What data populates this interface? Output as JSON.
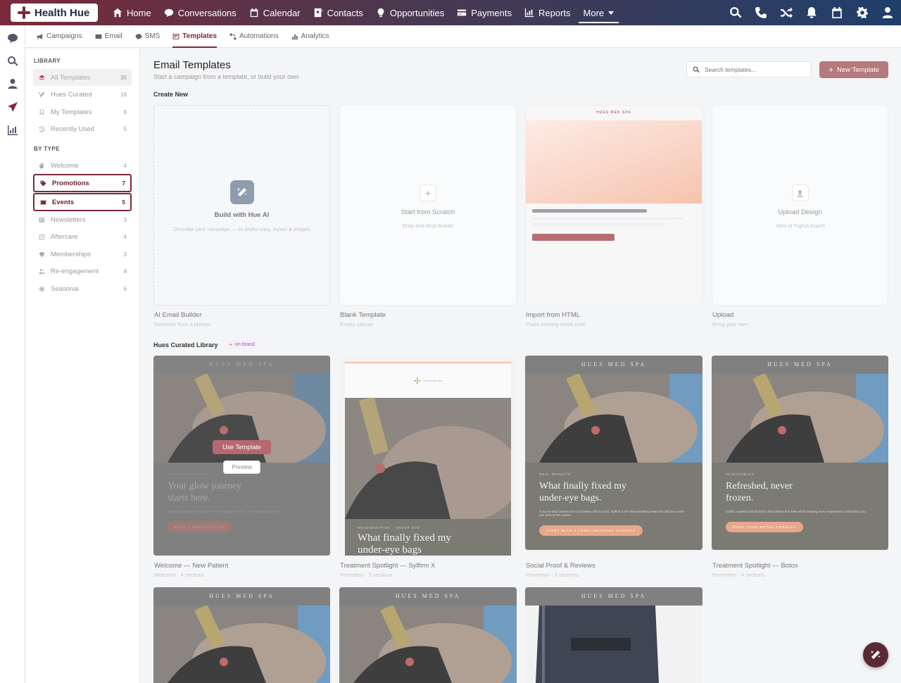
{
  "brand": {
    "name": "Health Hue"
  },
  "nav": {
    "items": [
      {
        "label": "Home",
        "icon": "home-icon"
      },
      {
        "label": "Conversations",
        "icon": "chat-icon"
      },
      {
        "label": "Calendar",
        "icon": "calendar-icon"
      },
      {
        "label": "Contacts",
        "icon": "contacts-icon"
      },
      {
        "label": "Opportunities",
        "icon": "lightbulb-icon"
      },
      {
        "label": "Payments",
        "icon": "credit-card-icon"
      },
      {
        "label": "Reports",
        "icon": "chart-icon"
      },
      {
        "label": "More",
        "icon": "chevron-down-icon"
      }
    ]
  },
  "subnav": {
    "items": [
      {
        "label": "Campaigns"
      },
      {
        "label": "Email"
      },
      {
        "label": "SMS"
      },
      {
        "label": "Templates"
      },
      {
        "label": "Automations"
      },
      {
        "label": "Analytics"
      }
    ],
    "active": "Templates"
  },
  "sidebar": {
    "library_title": "LIBRARY",
    "library": [
      {
        "label": "All Templates",
        "count": "36"
      },
      {
        "label": "Hues Curated",
        "count": "18"
      },
      {
        "label": "My Templates",
        "count": "9"
      },
      {
        "label": "Recently Used",
        "count": "5"
      }
    ],
    "type_title": "BY TYPE",
    "types": [
      {
        "label": "Welcome",
        "count": "4"
      },
      {
        "label": "Promotions",
        "count": "7"
      },
      {
        "label": "Events",
        "count": "5"
      },
      {
        "label": "Newsletters",
        "count": "3"
      },
      {
        "label": "Aftercare",
        "count": "4"
      },
      {
        "label": "Memberships",
        "count": "3"
      },
      {
        "label": "Re-engagement",
        "count": "4"
      },
      {
        "label": "Seasonal",
        "count": "6"
      }
    ]
  },
  "main": {
    "title": "Email Templates",
    "subtitle": "Start a campaign from a template, or build your own",
    "search_placeholder": "Search templates...",
    "new_button": "New Template",
    "create_new_title": "Create New",
    "create_cards": [
      {
        "inner_title": "Build with Hue AI",
        "inner_desc": "Describe your campaign — AI drafts copy, layout & images",
        "caption": "AI Email Builder",
        "caption_sub": "Generate from a prompt"
      },
      {
        "inner_title": "Start from Scratch",
        "inner_desc": "Drag-and-drop builder",
        "caption": "Blank Template",
        "caption_sub": "Empty canvas"
      },
      {
        "inner_title": "HUES MED SPA",
        "inner_desc": "",
        "caption": "Import from HTML",
        "caption_sub": "Paste existing email code"
      },
      {
        "inner_title": "Upload Design",
        "inner_desc": ".html or Figma export",
        "caption": "Upload",
        "caption_sub": "Bring your own"
      }
    ],
    "curated_title": "Hues Curated Library",
    "curated_badge": "on-brand",
    "templates": [
      {
        "header": "HUES MED SPA",
        "eyebrow": "WELCOME TO HUES",
        "headline": "Your glow journey starts here.",
        "copy": "Welcome to Hues Med Spa — we're so glad you're here. Your first visit is on us.",
        "cta": "BOOK A CONSULTATION",
        "caption": "Welcome — New Patient",
        "meta": "Welcome · 4 sections",
        "use_label": "Use Template",
        "preview_label": "Preview"
      },
      {
        "header": "Hues Med Spa",
        "eyebrow": "REGENERATIVE · UNDER EYE",
        "headline": "What finally fixed my under-eye bags",
        "copy": "",
        "cta": "",
        "caption": "Treatment Spotlight — Sylfirm X",
        "meta": "Promotion · 5 sections"
      },
      {
        "header": "HUES MED SPA",
        "eyebrow": "REAL RESULTS",
        "headline": "What finally fixed my under-eye bags.",
        "copy": "If you've tried creams and concealers with no luck, Sylfirm X RF Microneedling treats the delicate under-eye area at the source.",
        "cta": "START WITH A COMPLIMENTARY CONSULT",
        "caption": "Social Proof & Reviews",
        "meta": "Promotion · 6 sections"
      },
      {
        "header": "HUES MED SPA",
        "eyebrow": "INJECTABLES",
        "headline": "Refreshed, never frozen.",
        "copy": "Subtle, expertly placed Botox that softens fine lines while keeping every expression comfortably you.",
        "cta": "BOOK YOUR BOTOX CONSULT",
        "caption": "Treatment Spotlight — Botox",
        "meta": "Promotion · 4 sections"
      },
      {
        "header": "HUES MED SPA"
      },
      {
        "header": "HUES MED SPA"
      },
      {
        "header": "HUES MED SPA"
      }
    ]
  },
  "colors": {
    "accent": "#7a2a3a",
    "button": "#b47a7e"
  }
}
